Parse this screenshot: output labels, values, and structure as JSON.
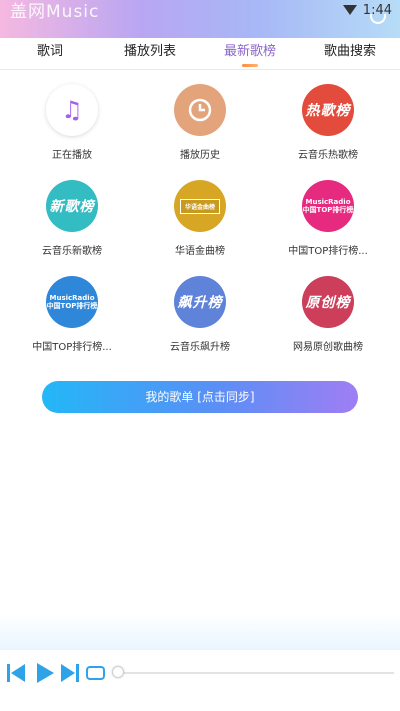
{
  "status_bar": {
    "app_title": "盖网Music",
    "time": "1:44"
  },
  "tabs": [
    {
      "label": "歌词",
      "active": false
    },
    {
      "label": "播放列表",
      "active": false
    },
    {
      "label": "最新歌榜",
      "active": true
    },
    {
      "label": "歌曲搜索",
      "active": false
    }
  ],
  "grid": [
    {
      "label": "正在播放",
      "icon": "music-note-icon",
      "badge": "♫"
    },
    {
      "label": "播放历史",
      "icon": "history-clock-icon",
      "badge": ""
    },
    {
      "label": "云音乐热歌榜",
      "icon": "hot-chart-icon",
      "badge": "热歌榜"
    },
    {
      "label": "云音乐新歌榜",
      "icon": "new-chart-icon",
      "badge": "新歌榜"
    },
    {
      "label": "华语金曲榜",
      "icon": "chinese-gold-chart-icon",
      "badge": "华语金曲榜"
    },
    {
      "label": "中国TOP排行榜...",
      "icon": "china-top-chart-icon",
      "badge": "MusicRadio 中国TOP排行榜"
    },
    {
      "label": "中国TOP排行榜...",
      "icon": "china-top-chart-icon",
      "badge": "MusicRadio 中国TOP排行榜"
    },
    {
      "label": "云音乐飙升榜",
      "icon": "rising-chart-icon",
      "badge": "飙升榜"
    },
    {
      "label": "网易原创歌曲榜",
      "icon": "original-chart-icon",
      "badge": "原创榜"
    }
  ],
  "sync_button": {
    "label": "我的歌单 [点击同步]"
  },
  "player": {
    "progress_fraction": 0.0,
    "accent": "#2fa3e8"
  },
  "colors": {
    "accent": "#8a67c9",
    "button_start": "#23b7f7",
    "button_end": "#9f7ef4"
  }
}
